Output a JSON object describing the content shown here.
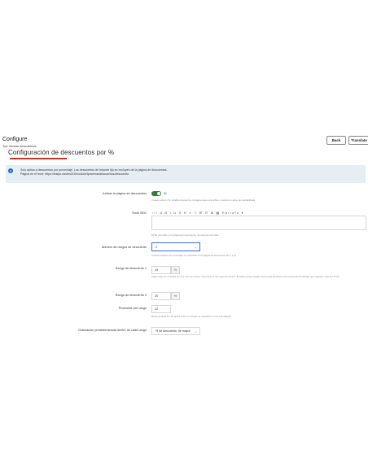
{
  "header": {
    "title": "Configure",
    "subtitle": "Tpc Vemas descuentos",
    "back_label": "Back",
    "translate_label": "Translate"
  },
  "section": {
    "title": "Configuración de descuentos por %"
  },
  "info": {
    "line1": "Solo aplica a descuentos por porcentaje. Los descuentos de importe fijo se excluyen de la página de descuentos.",
    "line2": "Página en el front: https://tvstpc.es/des015/module/tpcvemasdescuentos/descuento"
  },
  "form": {
    "activate": {
      "label": "Activar la página de descuentos",
      "value_label": "Sí",
      "enabled": true,
      "help": "Cuando esté en Sí, la tabla descuentos, la página sigue accesible e muestra un aviso de deshabilitada."
    },
    "seo_text": {
      "label": "Texto SEO",
      "toolbar": "‹/›  A  B  I  U  S  H  ∞  ≡  ☰  ☷  ⊞  ▦  Párrafo ▾",
      "help": "HTML permitido en la página de descuentos. Se aplicará a la vista."
    },
    "num_ranges": {
      "label": "Número de rangos de descuento",
      "value": "2",
      "help": "Cuántos bloques de porcentaje se mostrarán en la página de descuentos (de 1 a 5)."
    },
    "range1": {
      "label": "Rango de descuento 1",
      "value": "15",
      "addon": "%",
      "help1": "Cada rango se mostrará con %s. Por un número mayor que el del rango de mínimo. El último rango (desde mínimo) las productos por encima del % indicado (por ejemplo, más del 75 %)."
    },
    "range2": {
      "label": "Rango de descuento 2",
      "value": "20",
      "addon": "%"
    },
    "products_per_range": {
      "label": "Productos por rango",
      "value": "12",
      "help": "Recomendado 12. Se aplica todos los rangos se muestran en una sola página."
    },
    "default_order": {
      "label": "Ordenación predeterminada dentro de cada rango",
      "value": "% de descuento, de mayor"
    }
  }
}
